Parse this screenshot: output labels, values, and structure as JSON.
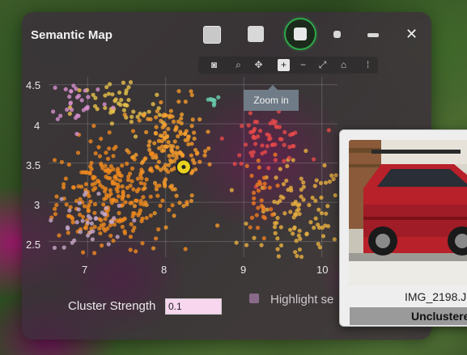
{
  "window": {
    "title": "Semantic Map",
    "close_label": "✕"
  },
  "modebar": {
    "tooltip": "Zoom in",
    "buttons": [
      "camera-icon",
      "zoom-icon",
      "pan-icon",
      "zoom-in-icon",
      "zoom-out-icon",
      "autoscale-icon",
      "home-icon",
      "plotly-logo-icon"
    ]
  },
  "plot": {
    "y_ticks": [
      "4.5",
      "4",
      "3.5",
      "3",
      "2.5"
    ],
    "x_ticks": [
      "7",
      "8",
      "9",
      "10"
    ]
  },
  "controls": {
    "cluster_strength_label": "Cluster Strength",
    "cluster_strength_value": "0.1",
    "highlight_label": "Highlight se"
  },
  "preview": {
    "filename": "IMG_2198.J",
    "cluster": "Unclustere"
  },
  "chart_data": {
    "type": "scatter",
    "xlim": [
      6.5,
      10.2
    ],
    "ylim": [
      2.3,
      4.6
    ],
    "x_ticks": [
      7,
      8,
      9,
      10
    ],
    "y_ticks": [
      2.5,
      3,
      3.5,
      4,
      4.5
    ],
    "grid": true,
    "highlight_point": {
      "x": 8.23,
      "y": 3.45
    },
    "clusters": [
      {
        "color": "#f08a1e",
        "cx": 7.3,
        "cy": 3.1,
        "sx": 0.35,
        "sy": 0.35,
        "n": 260
      },
      {
        "color": "#f59a2a",
        "cx": 8.1,
        "cy": 3.6,
        "sx": 0.25,
        "sy": 0.35,
        "n": 120
      },
      {
        "color": "#e8b040",
        "cx": 9.7,
        "cy": 2.8,
        "sx": 0.3,
        "sy": 0.35,
        "n": 110
      },
      {
        "color": "#e84a4a",
        "cx": 9.3,
        "cy": 3.8,
        "sx": 0.25,
        "sy": 0.15,
        "n": 60
      },
      {
        "color": "#f07a20",
        "cx": 9.2,
        "cy": 3.1,
        "sx": 0.1,
        "sy": 0.25,
        "n": 30
      },
      {
        "color": "#e8c24a",
        "cx": 7.4,
        "cy": 4.2,
        "sx": 0.3,
        "sy": 0.2,
        "n": 50
      },
      {
        "color": "#d890d0",
        "cx": 6.9,
        "cy": 4.3,
        "sx": 0.2,
        "sy": 0.15,
        "n": 30
      },
      {
        "color": "#6ad0b0",
        "cx": 8.6,
        "cy": 4.3,
        "sx": 0.05,
        "sy": 0.05,
        "n": 8
      },
      {
        "color": "#c8a8c8",
        "cx": 7.0,
        "cy": 2.75,
        "sx": 0.25,
        "sy": 0.2,
        "n": 40
      },
      {
        "color": "#f5a030",
        "cx": 8.0,
        "cy": 3.9,
        "sx": 0.2,
        "sy": 0.2,
        "n": 40
      }
    ]
  }
}
